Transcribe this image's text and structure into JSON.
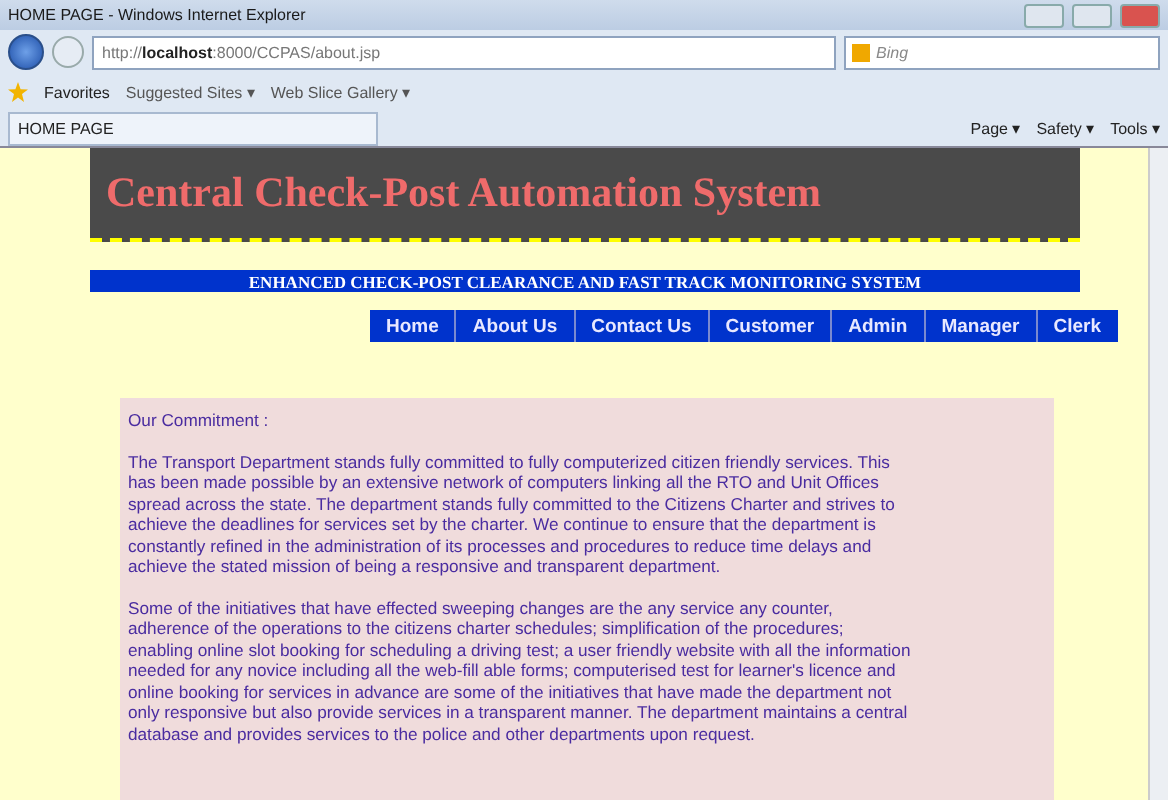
{
  "window": {
    "title": "HOME PAGE - Windows Internet Explorer"
  },
  "address_bar": {
    "url_prefix": "http://",
    "url_host": "localhost",
    "url_rest": ":8000/CCPAS/about.jsp"
  },
  "search": {
    "placeholder": "Bing"
  },
  "favorites_bar": {
    "label": "Favorites",
    "items": [
      "Suggested Sites ▾",
      "Web Slice Gallery ▾"
    ]
  },
  "tab": {
    "label": "HOME PAGE"
  },
  "command_bar": [
    "Page ▾",
    "Safety ▾",
    "Tools ▾"
  ],
  "banner": {
    "title": "Central Check-Post Automation System"
  },
  "subtitle": "ENHANCED CHECK-POST CLEARANCE AND FAST TRACK MONITORING SYSTEM",
  "nav": [
    {
      "label": "Home"
    },
    {
      "label": "About Us"
    },
    {
      "label": "Contact Us"
    },
    {
      "label": "Customer"
    },
    {
      "label": "Admin"
    },
    {
      "label": "Manager"
    },
    {
      "label": "Clerk"
    }
  ],
  "content": {
    "heading": "Our Commitment :",
    "paragraphs": [
      "The Transport Department stands fully committed to fully computerized citizen friendly services. This has been made possible by an extensive network of computers linking all the RTO and Unit Offices spread across the state. The department stands fully committed to the Citizens Charter and strives to achieve the deadlines for services set by the charter. We continue to ensure that the department is constantly refined in the administration of its processes and procedures to reduce time delays and achieve the stated mission of being a responsive and transparent department.",
      "Some of the initiatives that have effected sweeping changes are the any service any counter, adherence of the operations to the citizens charter schedules; simplification of the procedures; enabling online slot booking for scheduling a driving test; a user friendly website with all the information needed for any novice including all the web-fill able forms; computerised test for learner's licence and online booking for services in advance are some of the initiatives that have made the department not only responsive but also provide services in a transparent manner. The department maintains a central database and provides services to the police and other departments upon request."
    ]
  }
}
